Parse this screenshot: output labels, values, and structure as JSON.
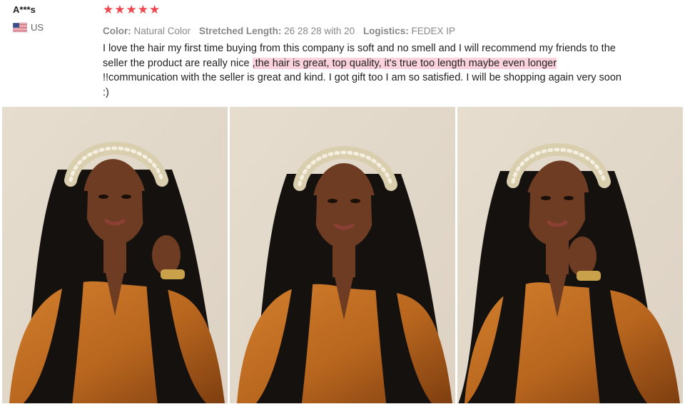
{
  "user": {
    "name": "A***s",
    "country": "US",
    "flag_icon": "us-flag-icon"
  },
  "rating": {
    "stars": 5,
    "max": 5,
    "color": "#f0474f"
  },
  "attributes": [
    {
      "key": "Color:",
      "value": "Natural Color"
    },
    {
      "key": "Stretched Length:",
      "value": "26 28 28 with 20"
    },
    {
      "key": "Logistics:",
      "value": "FEDEX IP"
    }
  ],
  "review": {
    "text_before": "I love the hair my first time buying from this company is soft and no smell and I will recommend my friends to the seller the product are really nice ",
    "text_highlight": ",the hair is great, top quality,  it's true too length maybe even longer",
    "text_after": " !!communication with the seller is great and kind. I got gift too I am so satisfied.  I will be shopping again very soon :)",
    "highlight_color": "#fbd3df"
  },
  "photos": [
    {
      "name": "review-photo-1",
      "pose": "front-hand-on-chin"
    },
    {
      "name": "review-photo-2",
      "pose": "front-centered"
    },
    {
      "name": "review-photo-3",
      "pose": "side-profile"
    }
  ],
  "colors": {
    "background_wall": "#ddd2c3",
    "shirt": "#b8661e",
    "hair": "#15110f",
    "skin": "#6e3c22",
    "headband": "#d9cfae"
  }
}
